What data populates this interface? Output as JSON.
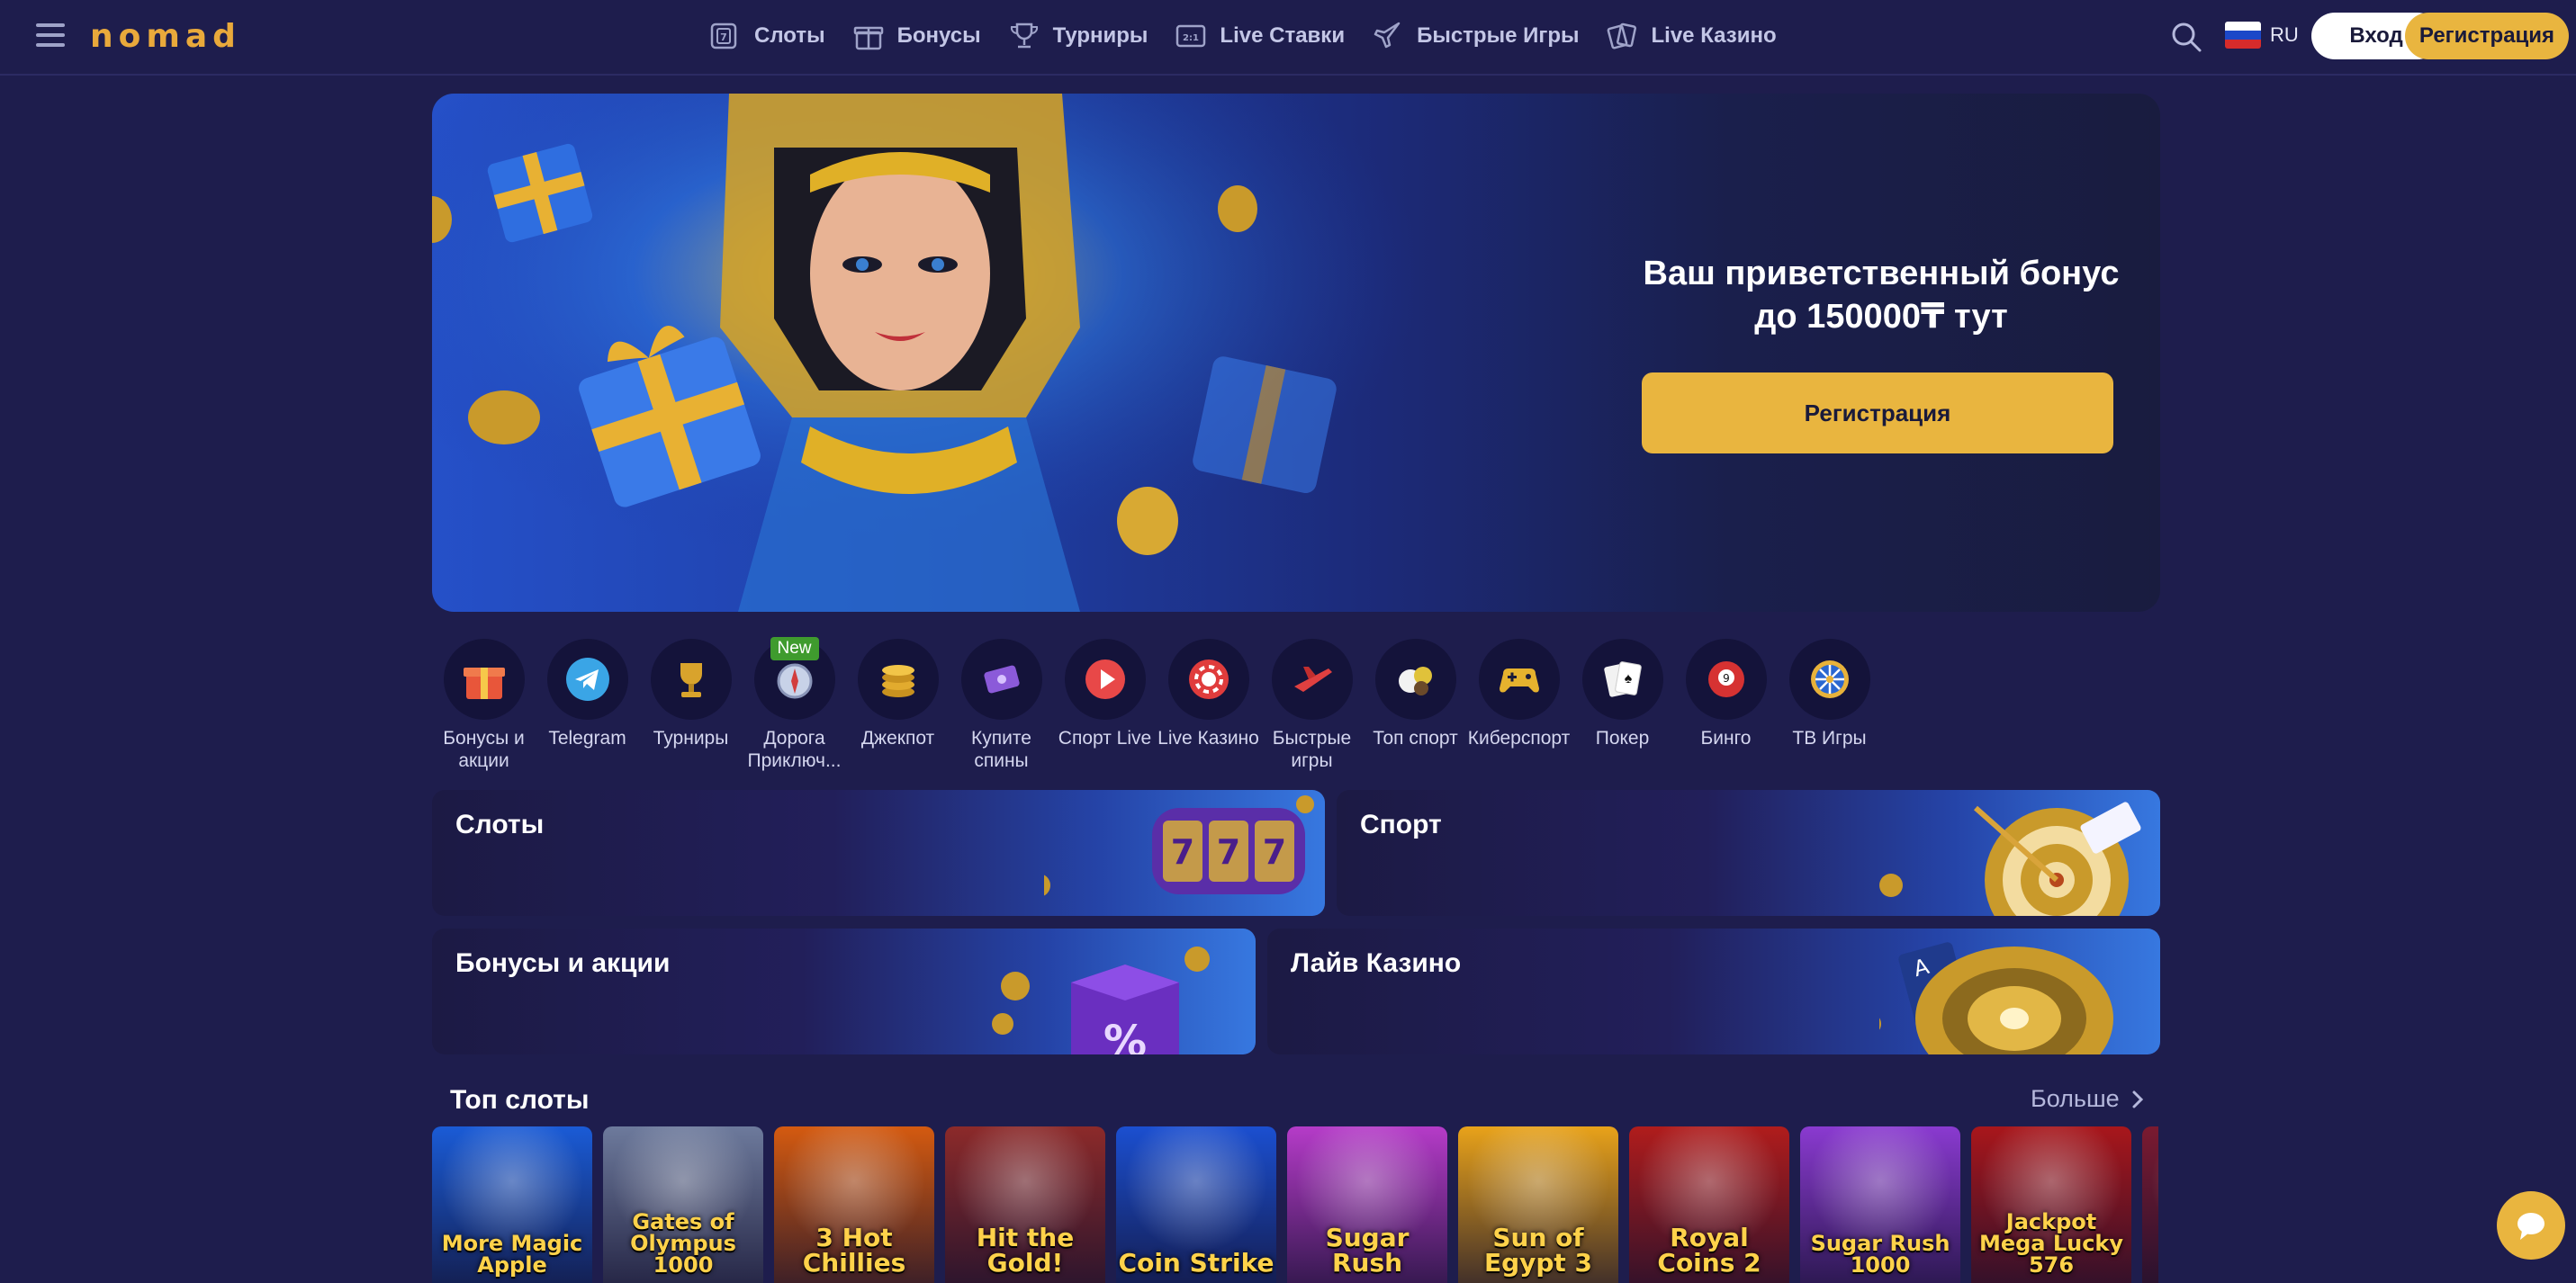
{
  "header": {
    "logo": "nomad",
    "nav": [
      {
        "label": "Слоты",
        "icon": "slot-icon"
      },
      {
        "label": "Бонусы",
        "icon": "gift-icon"
      },
      {
        "label": "Турниры",
        "icon": "trophy-icon"
      },
      {
        "label": "Live Ставки",
        "icon": "live-bets-icon"
      },
      {
        "label": "Быстрые Игры",
        "icon": "rocket-icon"
      },
      {
        "label": "Live Казино",
        "icon": "cards-icon"
      }
    ],
    "language": "RU",
    "login_label": "Вход",
    "register_label": "Регистрация"
  },
  "hero": {
    "title_line1": "Ваш приветственный бонус",
    "title_line2": "до 150000₸ тут",
    "button_label": "Регистрация"
  },
  "categories": [
    {
      "label": "Бонусы и акции",
      "icon": "gift-box-icon"
    },
    {
      "label": "Telegram",
      "icon": "telegram-icon"
    },
    {
      "label": "Турниры",
      "icon": "trophy-icon"
    },
    {
      "label": "Дорога Приключ...",
      "icon": "compass-icon",
      "badge": "New"
    },
    {
      "label": "Джекпот",
      "icon": "coins-icon"
    },
    {
      "label": "Купите спины",
      "icon": "ticket-icon"
    },
    {
      "label": "Спорт Live",
      "icon": "play-icon"
    },
    {
      "label": "Live Казино",
      "icon": "chip-icon"
    },
    {
      "label": "Быстрые игры",
      "icon": "plane-icon"
    },
    {
      "label": "Топ спорт",
      "icon": "balls-icon"
    },
    {
      "label": "Киберспорт",
      "icon": "gamepad-icon"
    },
    {
      "label": "Покер",
      "icon": "poker-cards-icon"
    },
    {
      "label": "Бинго",
      "icon": "bingo-ball-icon"
    },
    {
      "label": "ТВ Игры",
      "icon": "wheel-icon"
    }
  ],
  "sections": [
    {
      "title": "Слоты"
    },
    {
      "title": "Спорт"
    },
    {
      "title": "Бонусы и акции"
    },
    {
      "title": "Лайв Казино"
    }
  ],
  "top_slots": {
    "title": "Топ слоты",
    "more_label": "Больше",
    "games": [
      {
        "name": "More Magic Apple",
        "color": "#1a5bd6"
      },
      {
        "name": "Gates of Olympus 1000",
        "color": "#6d7a9c"
      },
      {
        "name": "3 Hot Chillies",
        "color": "#d45a10"
      },
      {
        "name": "Hit the Gold!",
        "color": "#8c2a2a"
      },
      {
        "name": "Coin Strike",
        "color": "#1b4fd0"
      },
      {
        "name": "Sugar Rush",
        "color": "#b53bc8"
      },
      {
        "name": "Sun of Egypt 3",
        "color": "#e8a21a"
      },
      {
        "name": "Royal Coins 2",
        "color": "#b01c1c"
      },
      {
        "name": "Sugar Rush 1000",
        "color": "#8a3ad0"
      },
      {
        "name": "Jackpot Mega Lucky 576",
        "color": "#a8161b"
      },
      {
        "name": "",
        "color": "#7a1a30"
      }
    ]
  },
  "colors": {
    "background": "#1e1d4d",
    "accent": "#e9b53f",
    "badge_new": "#3f9b2e"
  }
}
